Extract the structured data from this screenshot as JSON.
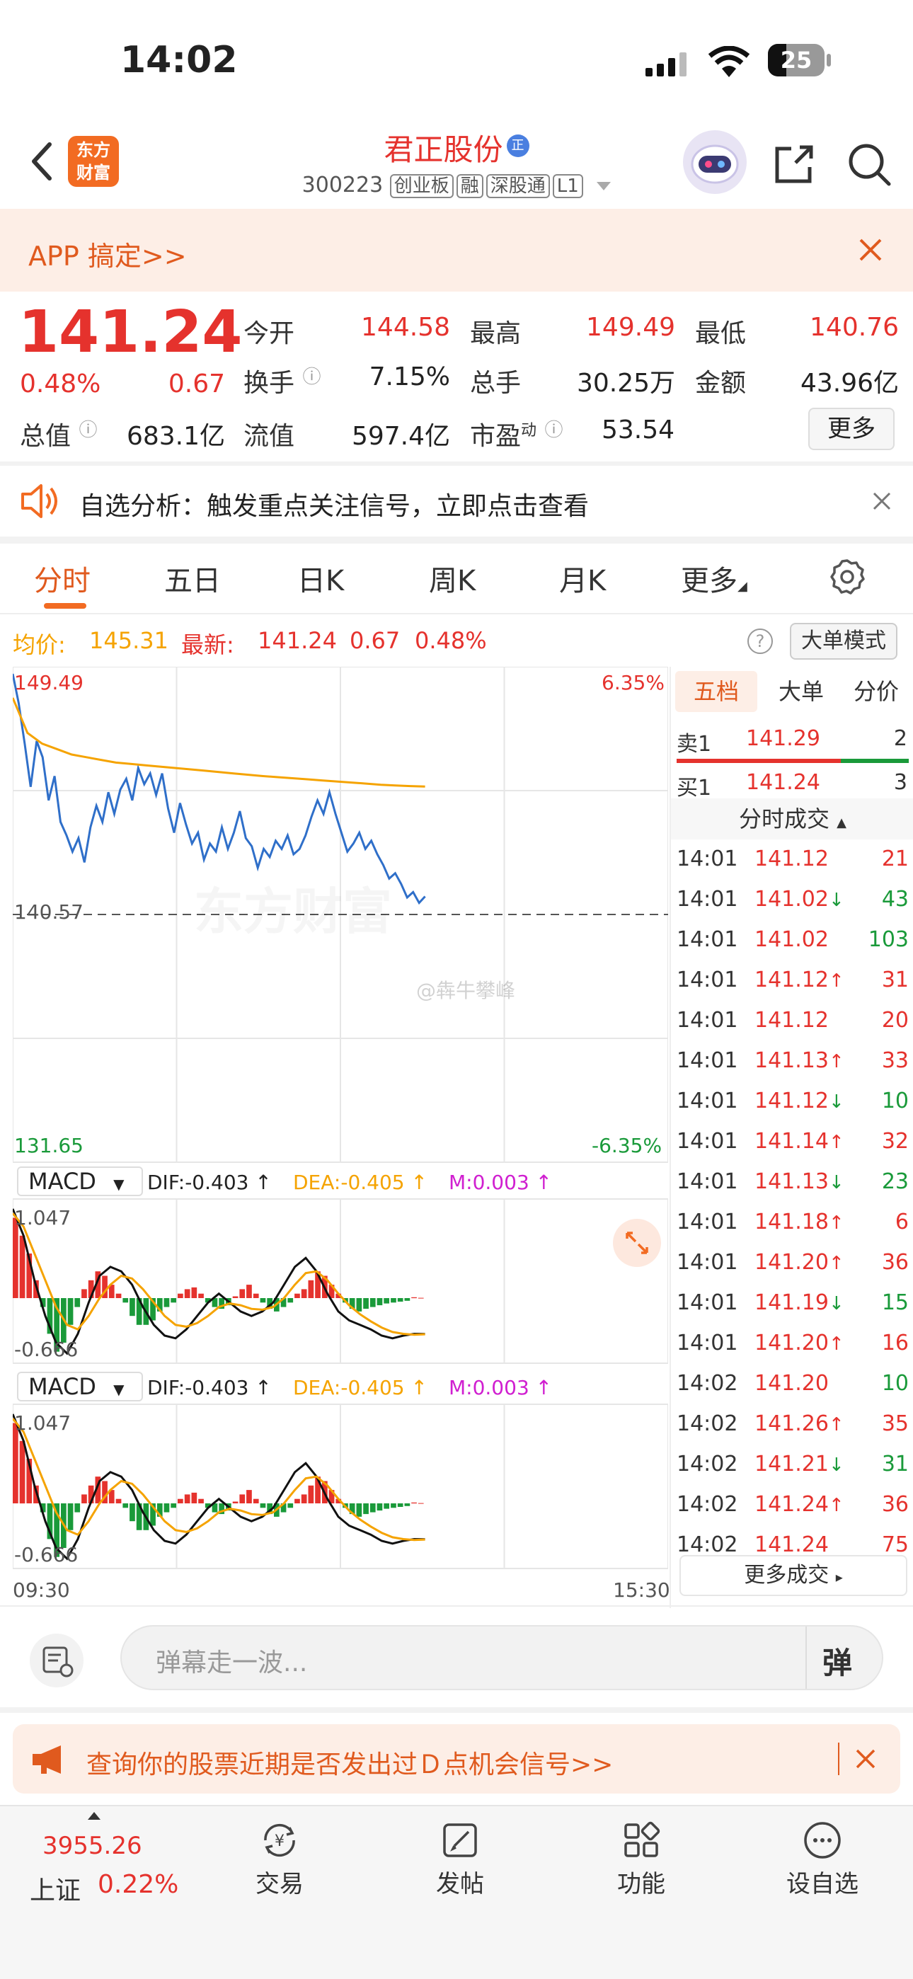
{
  "status": {
    "time": "14:02",
    "battery": "25"
  },
  "header": {
    "title": "君正股份",
    "title_badge": "正",
    "code": "300223",
    "tags": [
      "创业板",
      "融",
      "深股通",
      "L1"
    ],
    "logo_line1": "东方",
    "logo_line2": "财富"
  },
  "banner": {
    "text": "APP 搞定>>"
  },
  "quote": {
    "price": "141.24",
    "pct": "0.48%",
    "chg": "0.67",
    "row1": [
      {
        "label": "今开",
        "value": "144.58"
      },
      {
        "label": "最高",
        "value": "149.49"
      },
      {
        "label": "最低",
        "value": "140.76"
      }
    ],
    "row2": [
      {
        "label": "换手",
        "value": "7.15%"
      },
      {
        "label": "总手",
        "value": "30.25万"
      },
      {
        "label": "金额",
        "value": "43.96亿"
      }
    ],
    "row3": [
      {
        "label": "总值",
        "value": "683.1亿"
      },
      {
        "label": "流值",
        "value": "597.4亿"
      },
      {
        "label": "市盈",
        "sup": "动",
        "value": "53.54"
      }
    ],
    "more": "更多"
  },
  "notice": {
    "text": "自选分析：触发重点关注信号，立即点击查看"
  },
  "tabs": [
    "分时",
    "五日",
    "日K",
    "周K",
    "月K",
    "更多"
  ],
  "info_bar": {
    "avg_label": "均价:",
    "avg": "145.31",
    "last_label": "最新:",
    "last": "141.24",
    "chg": "0.67",
    "pct": "0.48%",
    "mode": "大单模式"
  },
  "chart_data": {
    "type": "line",
    "x_start": "09:30",
    "x_end": "15:30",
    "y_max": "149.49",
    "y_mid": "140.57",
    "y_min": "131.65",
    "pct_max": "6.35%",
    "pct_min": "-6.35%",
    "watermark": "东方财富",
    "weibo": "@犇牛攀峰",
    "price": [
      149.49,
      148.4,
      146.9,
      145.3,
      147.0,
      146.4,
      144.8,
      145.7,
      144.0,
      143.5,
      142.9,
      143.4,
      142.5,
      143.8,
      144.6,
      144.0,
      145.1,
      144.3,
      145.2,
      145.6,
      144.8,
      146.0,
      145.4,
      145.8,
      145.0,
      145.8,
      144.5,
      143.6,
      144.7,
      143.9,
      143.2,
      143.6,
      142.6,
      143.2,
      142.9,
      143.8,
      143.0,
      143.6,
      144.4,
      143.4,
      143.1,
      142.3,
      143.0,
      142.7,
      143.3,
      143.0,
      143.5,
      142.8,
      143.0,
      143.5,
      144.2,
      144.8,
      144.3,
      145.1,
      144.3,
      143.6,
      142.9,
      143.2,
      143.6,
      143.0,
      143.3,
      142.8,
      142.4,
      141.9,
      142.1,
      141.7,
      141.2,
      141.4,
      141.0,
      141.24
    ],
    "avg": [
      148.6,
      147.3,
      146.9,
      146.7,
      146.5,
      146.4,
      146.3,
      146.2,
      146.15,
      146.1,
      146.05,
      146.0,
      145.95,
      145.9,
      145.85,
      145.8,
      145.75,
      145.7,
      145.66,
      145.62,
      145.58,
      145.54,
      145.5,
      145.46,
      145.42,
      145.38,
      145.35,
      145.33,
      145.31
    ],
    "macd": {
      "dif": "-0.403",
      "dea": "-0.405",
      "m": "0.003",
      "top": "1.047",
      "bottom": "-0.666",
      "dif_series": [
        1.0,
        0.7,
        0.2,
        -0.2,
        -0.5,
        -0.62,
        -0.4,
        -0.05,
        0.25,
        0.35,
        0.3,
        0.15,
        -0.1,
        -0.3,
        -0.42,
        -0.45,
        -0.35,
        -0.2,
        -0.05,
        0.05,
        -0.05,
        -0.15,
        -0.2,
        -0.15,
        -0.05,
        0.15,
        0.35,
        0.45,
        0.3,
        0.05,
        -0.15,
        -0.25,
        -0.3,
        -0.35,
        -0.42,
        -0.45,
        -0.42,
        -0.4,
        -0.403
      ],
      "dea_series": [
        0.95,
        0.8,
        0.5,
        0.2,
        -0.1,
        -0.3,
        -0.35,
        -0.2,
        0.0,
        0.15,
        0.25,
        0.22,
        0.1,
        -0.05,
        -0.2,
        -0.3,
        -0.32,
        -0.28,
        -0.2,
        -0.1,
        -0.06,
        -0.08,
        -0.12,
        -0.13,
        -0.1,
        0.0,
        0.15,
        0.28,
        0.3,
        0.2,
        0.05,
        -0.08,
        -0.18,
        -0.26,
        -0.33,
        -0.38,
        -0.4,
        -0.41,
        -0.405
      ],
      "hist": [
        0.9,
        0.7,
        0.5,
        0.2,
        -0.1,
        -0.4,
        -0.6,
        -0.5,
        -0.3,
        -0.1,
        0.1,
        0.2,
        0.3,
        0.25,
        0.15,
        0.05,
        -0.05,
        -0.2,
        -0.3,
        -0.3,
        -0.25,
        -0.15,
        -0.1,
        -0.05,
        0.05,
        0.1,
        0.12,
        0.05,
        -0.05,
        -0.1,
        -0.12,
        -0.08,
        0.02,
        0.1,
        0.15,
        0.05,
        -0.05,
        -0.12,
        -0.15,
        -0.1,
        -0.05,
        0.05,
        0.1,
        0.2,
        0.3,
        0.25,
        0.15,
        0.05,
        -0.05,
        -0.12,
        -0.15,
        -0.12,
        -0.1,
        -0.08,
        -0.06,
        -0.05,
        -0.04,
        -0.03,
        0.01,
        0.003
      ]
    }
  },
  "side": {
    "tabs": [
      "五档",
      "大单",
      "分价"
    ],
    "sell_label": "卖1",
    "sell_price": "141.29",
    "sell_vol": "2",
    "buy_label": "买1",
    "buy_price": "141.24",
    "buy_vol": "3",
    "trades_title": "分时成交",
    "trades": [
      {
        "t": "14:01",
        "p": "141.12",
        "a": "",
        "v": "21",
        "c": "red"
      },
      {
        "t": "14:01",
        "p": "141.02",
        "a": "↓",
        "v": "43",
        "c": "green"
      },
      {
        "t": "14:01",
        "p": "141.02",
        "a": "",
        "v": "103",
        "c": "green"
      },
      {
        "t": "14:01",
        "p": "141.12",
        "a": "↑",
        "v": "31",
        "c": "red"
      },
      {
        "t": "14:01",
        "p": "141.12",
        "a": "",
        "v": "20",
        "c": "red"
      },
      {
        "t": "14:01",
        "p": "141.13",
        "a": "↑",
        "v": "33",
        "c": "red"
      },
      {
        "t": "14:01",
        "p": "141.12",
        "a": "↓",
        "v": "10",
        "c": "green"
      },
      {
        "t": "14:01",
        "p": "141.14",
        "a": "↑",
        "v": "32",
        "c": "red"
      },
      {
        "t": "14:01",
        "p": "141.13",
        "a": "↓",
        "v": "23",
        "c": "green"
      },
      {
        "t": "14:01",
        "p": "141.18",
        "a": "↑",
        "v": "6",
        "c": "red"
      },
      {
        "t": "14:01",
        "p": "141.20",
        "a": "↑",
        "v": "36",
        "c": "red"
      },
      {
        "t": "14:01",
        "p": "141.19",
        "a": "↓",
        "v": "15",
        "c": "green"
      },
      {
        "t": "14:01",
        "p": "141.20",
        "a": "↑",
        "v": "16",
        "c": "red"
      },
      {
        "t": "14:02",
        "p": "141.20",
        "a": "",
        "v": "10",
        "c": "green"
      },
      {
        "t": "14:02",
        "p": "141.26",
        "a": "↑",
        "v": "35",
        "c": "red"
      },
      {
        "t": "14:02",
        "p": "141.21",
        "a": "↓",
        "v": "31",
        "c": "green"
      },
      {
        "t": "14:02",
        "p": "141.24",
        "a": "↑",
        "v": "36",
        "c": "red"
      },
      {
        "t": "14:02",
        "p": "141.24",
        "a": "",
        "v": "75",
        "c": "red"
      }
    ],
    "more": "更多成交"
  },
  "danmu": {
    "placeholder": "弹幕走一波...",
    "btn": "弹"
  },
  "ad": {
    "text": "查询你的股票近期是否发出过Ｄ点机会信号>>"
  },
  "bottom": {
    "index_value": "3955.26",
    "index_name": "上证",
    "index_pct": "0.22%",
    "items": [
      "交易",
      "发帖",
      "功能",
      "设自选"
    ]
  },
  "colors": {
    "red": "#e5322d",
    "green": "#1a9a3a",
    "orange": "#f5a300",
    "blue": "#2f6fc9",
    "banner_bg": "#fdeee6"
  }
}
